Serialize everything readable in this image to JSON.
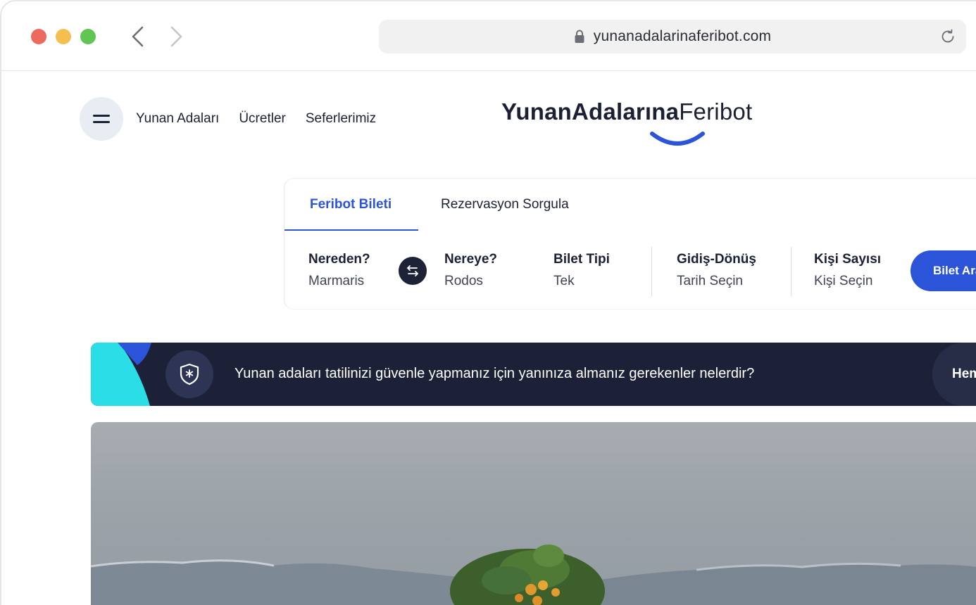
{
  "browser": {
    "url": "yunanadalarinaferibot.com",
    "icons": [
      "back-arrow-icon",
      "forward-arrow-icon",
      "lock-icon",
      "reload-icon"
    ],
    "traffic_lights": {
      "close": "#ed6a5e",
      "minimize": "#f5bf4f",
      "maximize": "#61c554"
    }
  },
  "header": {
    "menu_icon": "hamburger-icon",
    "nav": [
      "Yunan Adaları",
      "Ücretler",
      "Seferlerimiz"
    ],
    "logo": {
      "bold": "YunanAdalarına",
      "light": "Feribot"
    }
  },
  "search": {
    "tabs": {
      "active": "Feribot Bileti",
      "inactive": "Rezervasyon Sorgula"
    },
    "from": {
      "label": "Nereden?",
      "value": "Marmaris"
    },
    "to": {
      "label": "Nereye?",
      "value": "Rodos"
    },
    "ticket_type": {
      "label": "Bilet Tipi",
      "value": "Tek"
    },
    "dates": {
      "label": "Gidiş-Dönüş",
      "value": "Tarih Seçin"
    },
    "passengers": {
      "label": "Kişi Sayısı",
      "value": "Kişi Seçin"
    },
    "button": "Bilet Ara",
    "swap_icon": "swap-arrows-icon"
  },
  "banner": {
    "icon": "shield-star-icon",
    "text": "Yunan adaları tatilinizi güvenle yapmanız için yanınıza almanız gerekenler nelerdir?",
    "cta": "Hemen Oku"
  },
  "colors": {
    "accent": "#2c54d9",
    "dark": "#1c2138",
    "teal": "#2bdde6",
    "text": "#1b2035"
  }
}
